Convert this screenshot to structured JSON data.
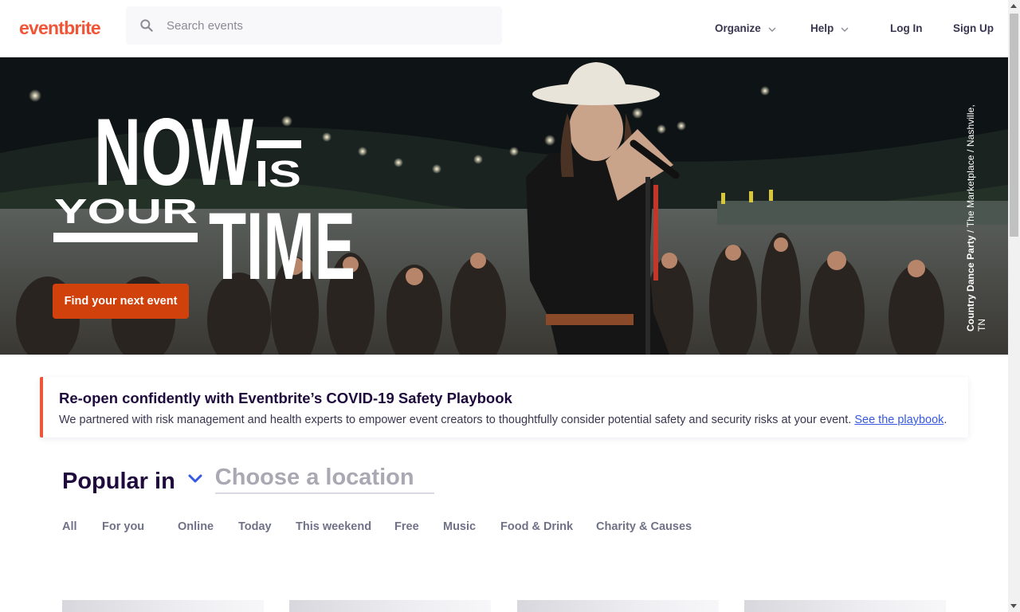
{
  "colors": {
    "brand": "#f05537",
    "cta": "#d1410c",
    "link": "#3659e3",
    "text_dark": "#1e0a3c"
  },
  "header": {
    "logo_text": "eventbrite",
    "search": {
      "placeholder": "Search events",
      "icon": "search-icon"
    },
    "nav": {
      "organize": "Organize",
      "help": "Help",
      "login": "Log In",
      "signup": "Sign Up"
    }
  },
  "hero": {
    "headline": {
      "now": "NOW",
      "is": "IS",
      "your": "YOUR",
      "time": "TIME"
    },
    "cta_label": "Find your next event",
    "caption_bold": "Country Dance Party",
    "caption_rest": " / The Marketplace / Nashville, TN"
  },
  "covid": {
    "title": "Re-open confidently with Eventbrite’s COVID-19 Safety Playbook",
    "text": "We partnered with risk management and health experts to empower event creators to thoughtfully consider potential safety and security risks at your event. ",
    "link": "See the playbook",
    "after_link": "."
  },
  "popular": {
    "label": "Popular in",
    "location_placeholder": "Choose a location",
    "tabs": [
      "All",
      "For you",
      "Online",
      "Today",
      "This weekend",
      "Free",
      "Music",
      "Food & Drink",
      "Charity & Causes"
    ]
  }
}
